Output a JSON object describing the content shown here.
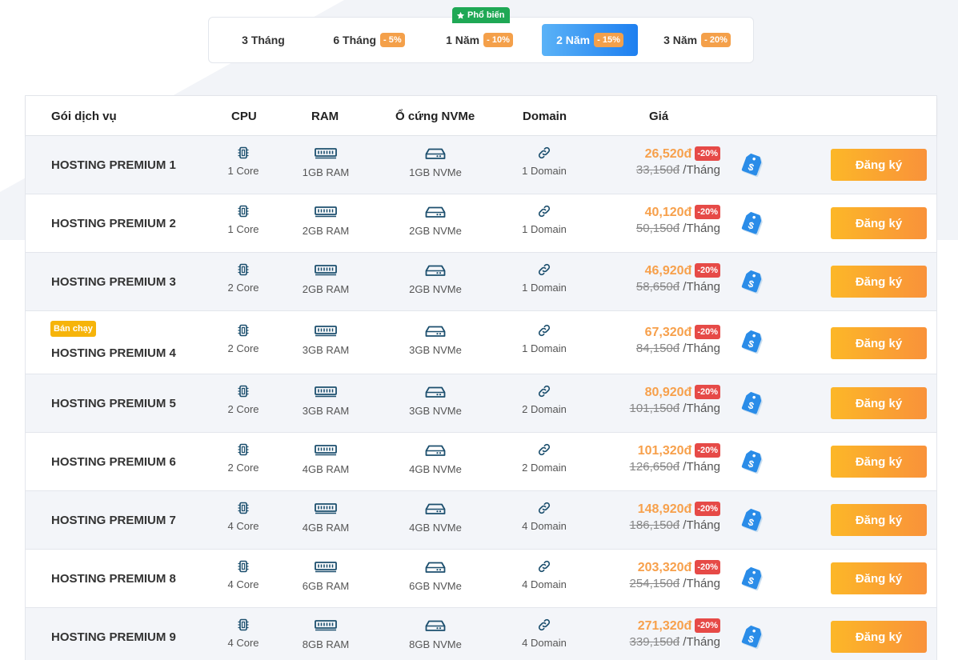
{
  "tabs": [
    {
      "label": "3 Tháng",
      "discount": ""
    },
    {
      "label": "6 Tháng",
      "discount": "- 5%"
    },
    {
      "label": "1 Năm",
      "discount": "- 10%"
    },
    {
      "label": "2 Năm",
      "discount": "- 15%"
    },
    {
      "label": "3 Năm",
      "discount": "- 20%"
    }
  ],
  "active_tab": 3,
  "popular_label": "Phổ biến",
  "headers": {
    "service": "Gói dịch vụ",
    "cpu": "CPU",
    "ram": "RAM",
    "disk": "Ổ cứng NVMe",
    "domain": "Domain",
    "price": "Giá"
  },
  "bestseller_label": "Bán chạy",
  "register_label": "Đăng ký",
  "per_unit": "/Tháng",
  "discount_pct": "-20%",
  "plans": [
    {
      "name": "HOSTING PREMIUM 1",
      "cpu": "1 Core",
      "ram": "1GB RAM",
      "disk": "1GB NVMe",
      "domain": "1 Domain",
      "price": "26,520đ",
      "old_price": "33,150đ"
    },
    {
      "name": "HOSTING PREMIUM 2",
      "cpu": "1 Core",
      "ram": "2GB RAM",
      "disk": "2GB NVMe",
      "domain": "1 Domain",
      "price": "40,120đ",
      "old_price": "50,150đ"
    },
    {
      "name": "HOSTING PREMIUM 3",
      "cpu": "2 Core",
      "ram": "2GB RAM",
      "disk": "2GB NVMe",
      "domain": "1 Domain",
      "price": "46,920đ",
      "old_price": "58,650đ"
    },
    {
      "name": "HOSTING PREMIUM 4",
      "cpu": "2 Core",
      "ram": "3GB RAM",
      "disk": "3GB NVMe",
      "domain": "1 Domain",
      "price": "67,320đ",
      "old_price": "84,150đ",
      "bestseller": true
    },
    {
      "name": "HOSTING PREMIUM 5",
      "cpu": "2 Core",
      "ram": "3GB RAM",
      "disk": "3GB NVMe",
      "domain": "2 Domain",
      "price": "80,920đ",
      "old_price": "101,150đ"
    },
    {
      "name": "HOSTING PREMIUM 6",
      "cpu": "2 Core",
      "ram": "4GB RAM",
      "disk": "4GB NVMe",
      "domain": "2 Domain",
      "price": "101,320đ",
      "old_price": "126,650đ"
    },
    {
      "name": "HOSTING PREMIUM 7",
      "cpu": "4 Core",
      "ram": "4GB RAM",
      "disk": "4GB NVMe",
      "domain": "4 Domain",
      "price": "148,920đ",
      "old_price": "186,150đ"
    },
    {
      "name": "HOSTING PREMIUM 8",
      "cpu": "4 Core",
      "ram": "6GB RAM",
      "disk": "6GB NVMe",
      "domain": "4 Domain",
      "price": "203,320đ",
      "old_price": "254,150đ"
    },
    {
      "name": "HOSTING PREMIUM 9",
      "cpu": "4 Core",
      "ram": "8GB RAM",
      "disk": "8GB NVMe",
      "domain": "4 Domain",
      "price": "271,320đ",
      "old_price": "339,150đ"
    }
  ],
  "colors": {
    "accent_blue": "#1e7ff0",
    "price_orange": "#f7a04b",
    "discount_red": "#e64a47",
    "button_orange": "#f9923a",
    "popular_green": "#1fa855",
    "bestseller_yellow": "#f6b40a",
    "icon_navy": "#1c4f6e",
    "tag_blue": "#2a8ce8"
  },
  "icons": {
    "cpu": "chip-icon",
    "ram": "memory-icon",
    "disk": "hard-drive-icon",
    "domain": "link-icon",
    "tag": "price-tag-icon",
    "popular": "star-icon"
  }
}
